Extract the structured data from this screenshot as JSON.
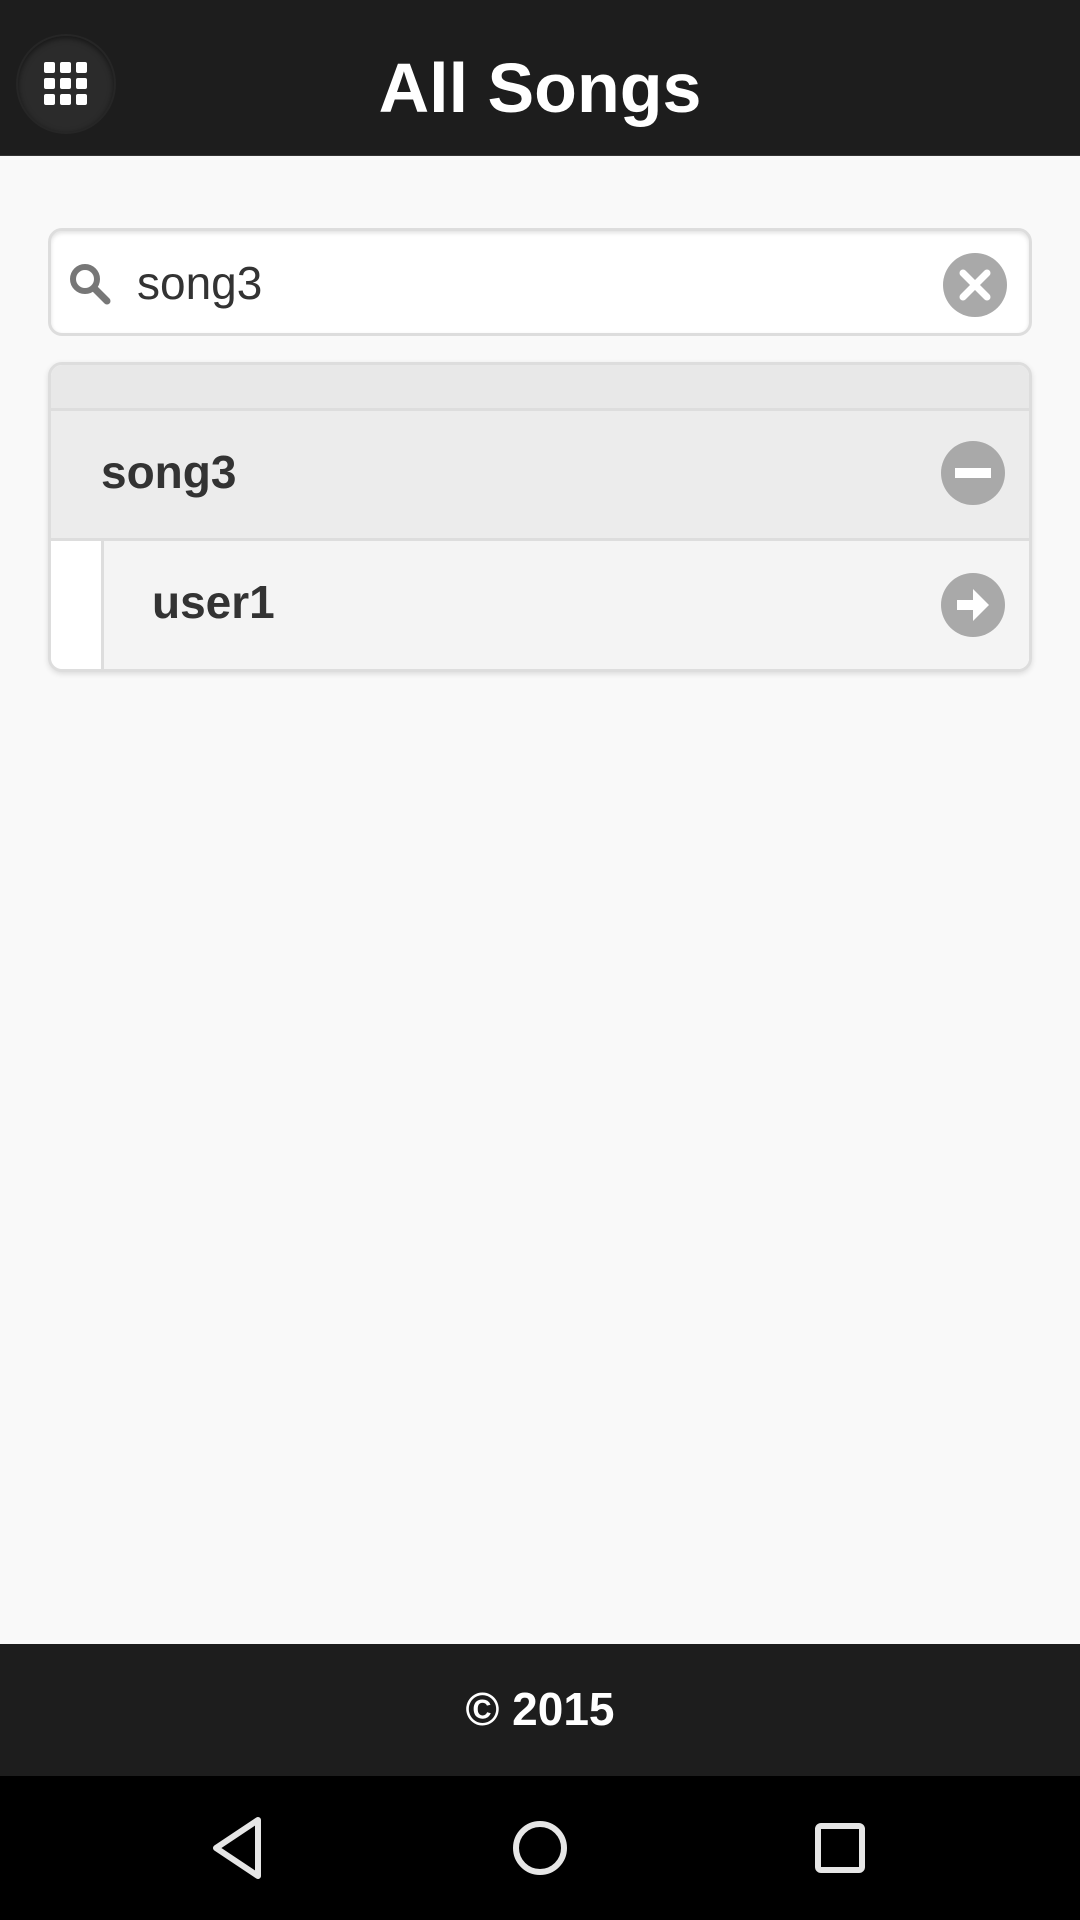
{
  "header": {
    "title": "All Songs",
    "menu_icon": "grid-icon"
  },
  "search": {
    "value": "song3",
    "placeholder": "",
    "search_icon": "search-icon",
    "clear_icon": "clear-icon"
  },
  "list": {
    "song": {
      "label": "song3",
      "icon": "minus-icon"
    },
    "items": [
      {
        "label": "user1",
        "icon": "arrow-right-icon"
      }
    ]
  },
  "footer": {
    "text": "© 2015"
  },
  "navbar": {
    "back_icon": "back-icon",
    "home_icon": "home-icon",
    "recent_icon": "recent-apps-icon"
  },
  "colors": {
    "header_bg": "#1d1d1d",
    "page_bg": "#f9f9f9",
    "icon_gray": "#a9a9a9",
    "text_dark": "#333333"
  }
}
